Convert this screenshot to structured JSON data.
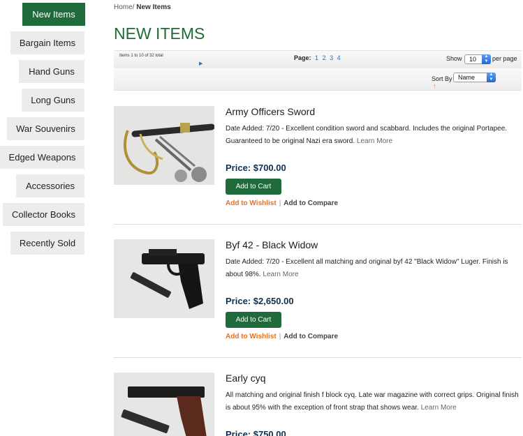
{
  "sidebar": {
    "items": [
      {
        "label": "New Items",
        "active": true
      },
      {
        "label": "Bargain Items"
      },
      {
        "label": "Hand Guns"
      },
      {
        "label": "Long Guns"
      },
      {
        "label": "War Souvenirs"
      },
      {
        "label": "Edged Weapons"
      },
      {
        "label": "Accessories"
      },
      {
        "label": "Collector Books"
      },
      {
        "label": "Recently Sold"
      }
    ]
  },
  "breadcrumb": {
    "home": "Home",
    "separator": "/",
    "current": "New Items"
  },
  "page_title": "NEW ITEMS",
  "toolbar": {
    "items_total": "Items 1 to 10 of 32 total",
    "page_label": "Page:",
    "pages": [
      "1",
      "2",
      "3",
      "4"
    ],
    "show_label": "Show",
    "per_page_value": "10",
    "per_page_label": "per page",
    "sort_label": "Sort By",
    "sort_value": "Name"
  },
  "products": [
    {
      "name": "Army Officers Sword",
      "description": "Date Added: 7/20 - Excellent condition sword and scabbard. Includes the original Portapee. Guaranteed to be original Nazi era sword.",
      "learn_more": "Learn More",
      "price": "Price: $700.00",
      "cart_label": "Add to Cart",
      "wishlist_label": "Add to Wishlist",
      "separator": "|",
      "compare_label": "Add to Compare",
      "image": "sword-image"
    },
    {
      "name": "Byf 42 - Black Widow",
      "description": "Date Added: 7/20 - Excellent all matching and original byf 42 \"Black Widow\" Luger. Finish is about 98%.",
      "learn_more": "Learn More",
      "price": "Price: $2,650.00",
      "cart_label": "Add to Cart",
      "wishlist_label": "Add to Wishlist",
      "separator": "|",
      "compare_label": "Add to Compare",
      "image": "luger-pistol-image"
    },
    {
      "name": "Early cyq",
      "description": "All matching and original finish f block cyq. Late war magazine with correct grips. Original finish is about 95% with the exception of front strap that shows wear.",
      "learn_more": "Learn More",
      "price": "Price: $750.00",
      "image": "p38-pistol-image"
    }
  ],
  "colors": {
    "accent": "#206b3c",
    "title": "#1e6b37",
    "link": "#2a6cc8",
    "wishlist": "#e8701f",
    "price": "#0f2f4f"
  }
}
